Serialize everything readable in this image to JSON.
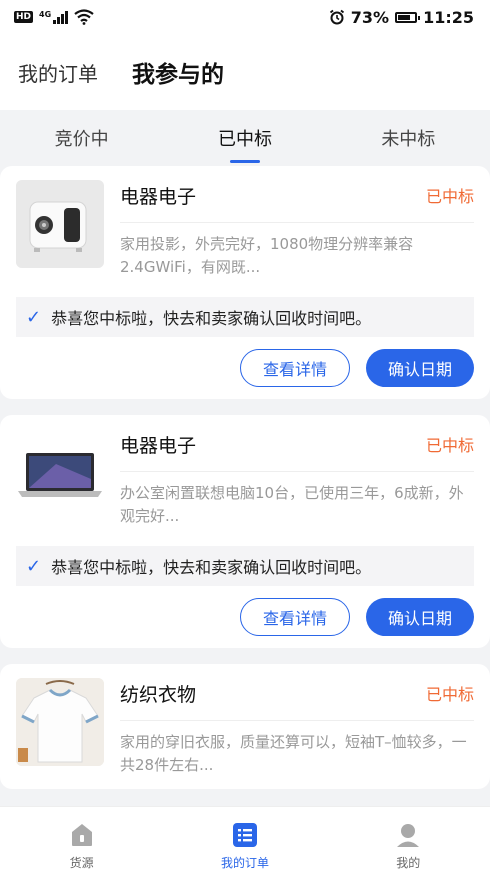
{
  "status_bar": {
    "hd": "HD",
    "network": "4G",
    "battery": "73%",
    "time": "11:25"
  },
  "header": {
    "tabs": [
      {
        "label": "我的订单",
        "active": false
      },
      {
        "label": "我参与的",
        "active": true
      }
    ]
  },
  "sub_tabs": [
    {
      "label": "竞价中",
      "active": false
    },
    {
      "label": "已中标",
      "active": true
    },
    {
      "label": "未中标",
      "active": false
    }
  ],
  "cards": [
    {
      "title": "电器电子",
      "status": "已中标",
      "desc": "家用投影，外壳完好，1080物理分辨率兼容2.4GWiFi，有网既...",
      "notice": "恭喜您中标啦，快去和卖家确认回收时间吧。",
      "detail_label": "查看详情",
      "confirm_label": "确认日期",
      "thumb": "projector-image"
    },
    {
      "title": "电器电子",
      "status": "已中标",
      "desc": "办公室闲置联想电脑10台，已使用三年，6成新，外观完好...",
      "notice": "恭喜您中标啦，快去和卖家确认回收时间吧。",
      "detail_label": "查看详情",
      "confirm_label": "确认日期",
      "thumb": "laptop-image"
    },
    {
      "title": "纺织衣物",
      "status": "已中标",
      "desc": "家用的穿旧衣服，质量还算可以，短袖T–恤较多，一共28件左右...",
      "thumb": "tshirt-image"
    }
  ],
  "bottom_nav": [
    {
      "label": "货源",
      "icon": "home-icon",
      "active": false
    },
    {
      "label": "我的订单",
      "icon": "list-icon",
      "active": true
    },
    {
      "label": "我的",
      "icon": "user-icon",
      "active": false
    }
  ],
  "colors": {
    "accent": "#2a66e8",
    "status": "#f06a35",
    "background": "#f2f3f5"
  }
}
